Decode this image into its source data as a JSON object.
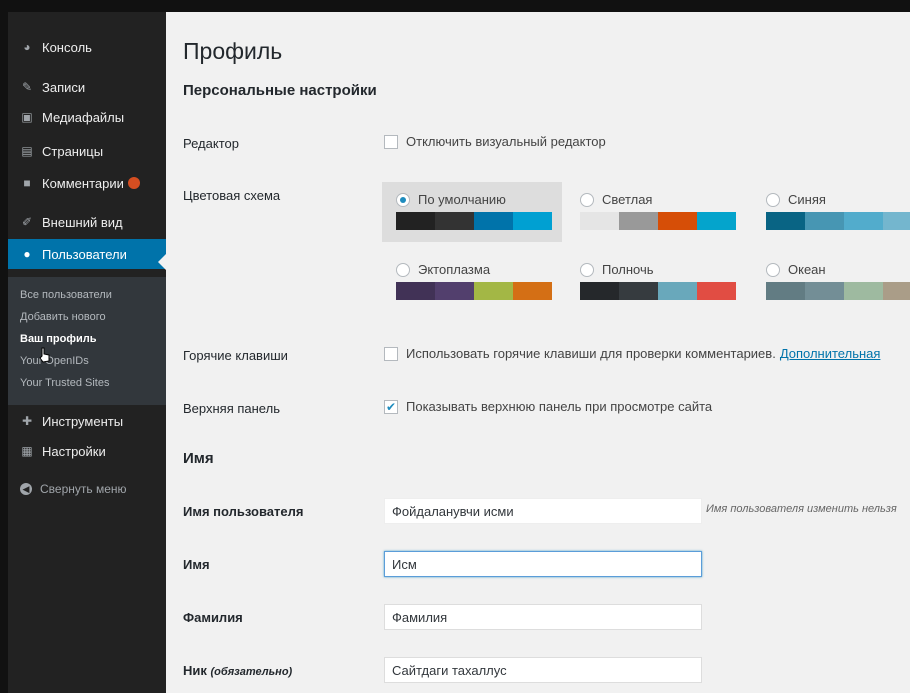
{
  "sidebar": {
    "items": [
      {
        "label": "Консоль",
        "icon": "dashboard-icon"
      },
      {
        "label": "Записи",
        "icon": "pin-icon"
      },
      {
        "label": "Медиафайлы",
        "icon": "media-icon"
      },
      {
        "label": "Страницы",
        "icon": "page-icon"
      },
      {
        "label": "Комментарии",
        "icon": "comment-icon"
      },
      {
        "label": "Внешний вид",
        "icon": "brush-icon"
      },
      {
        "label": "Пользователи",
        "icon": "user-icon"
      },
      {
        "label": "Инструменты",
        "icon": "wrench-icon"
      },
      {
        "label": "Настройки",
        "icon": "settings-icon"
      }
    ],
    "submenu": [
      "Все пользователи",
      "Добавить нового",
      "Ваш профиль",
      "Your OpenIDs",
      "Your Trusted Sites"
    ],
    "collapse_label": "Свернуть меню"
  },
  "page": {
    "title": "Профиль",
    "personal_section": "Персональные настройки",
    "editor_label": "Редактор",
    "editor_option": "Отключить визуальный редактор",
    "scheme_label": "Цветовая схема",
    "schemes": [
      {
        "name": "По умолчанию",
        "selected": true,
        "colors": [
          "#222222",
          "#333333",
          "#0073aa",
          "#00a0d2"
        ]
      },
      {
        "name": "Светлая",
        "selected": false,
        "colors": [
          "#e5e5e5",
          "#999999",
          "#d64e07",
          "#04a4cc"
        ]
      },
      {
        "name": "Синяя",
        "selected": false,
        "colors": [
          "#096484",
          "#4796b3",
          "#52accc",
          "#74b6ce"
        ]
      },
      {
        "name": "Эктоплазма",
        "selected": false,
        "colors": [
          "#413256",
          "#523f6d",
          "#a3b745",
          "#d46f15"
        ]
      },
      {
        "name": "Полночь",
        "selected": false,
        "colors": [
          "#25282b",
          "#363b3f",
          "#69a8bb",
          "#e14d43"
        ]
      },
      {
        "name": "Океан",
        "selected": false,
        "colors": [
          "#627c83",
          "#738e96",
          "#9ebaa0",
          "#aa9d88"
        ]
      }
    ],
    "hotkeys_label": "Горячие клавиши",
    "hotkeys_option": "Использовать горячие клавиши для проверки комментариев.",
    "hotkeys_link": "Дополнительная",
    "toolbar_label": "Верхняя панель",
    "toolbar_option": "Показывать верхнюю панель при просмотре сайта",
    "name_section": "Имя",
    "username_label": "Имя пользователя",
    "username_value": "Фойдаланувчи исми",
    "username_desc": "Имя пользователя изменить нельзя",
    "firstname_label": "Имя",
    "firstname_value": "Исм",
    "lastname_label": "Фамилия",
    "lastname_value": "Фамилия",
    "nick_label": "Ник",
    "nick_required": "(обязательно)",
    "nick_value": "Сайтдаги тахаллус"
  },
  "colors": {
    "sidebar_bg": "#222222",
    "active_bg": "#0073aa",
    "accent": "#1e8cbe"
  }
}
